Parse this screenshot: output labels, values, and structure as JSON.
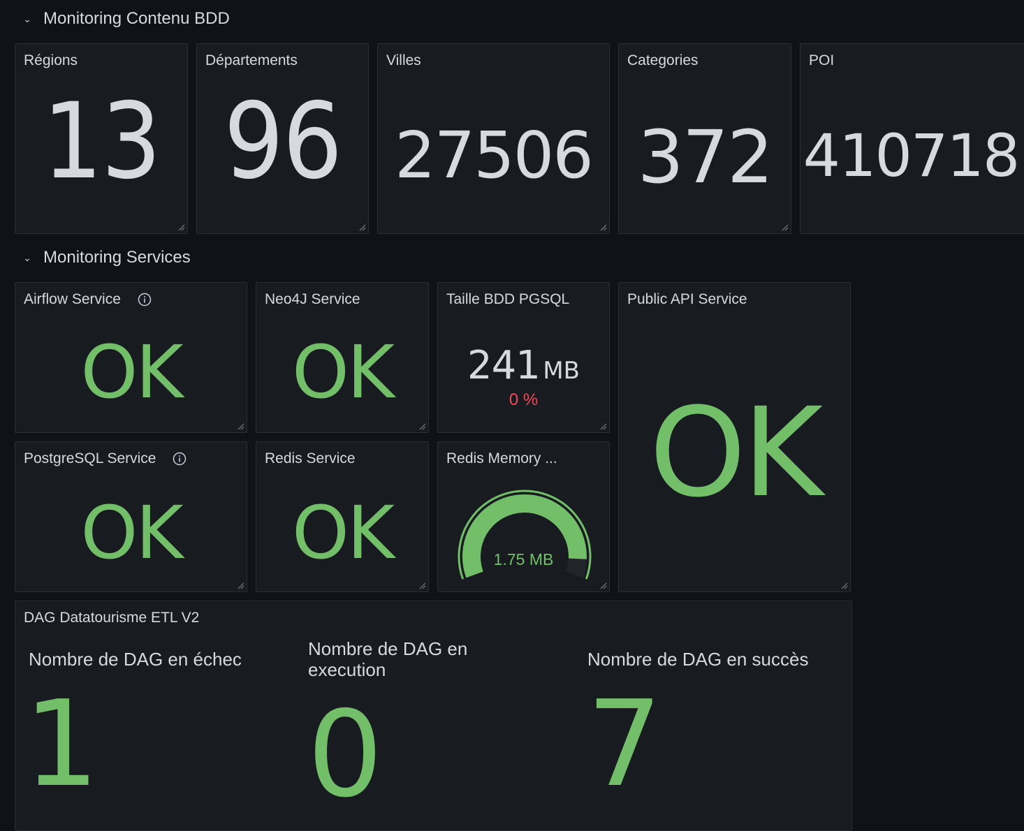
{
  "rows": {
    "bdd": {
      "title": "Monitoring Contenu BDD"
    },
    "services": {
      "title": "Monitoring Services"
    }
  },
  "stats": {
    "regions": {
      "title": "Régions",
      "value": "13"
    },
    "departements": {
      "title": "Départements",
      "value": "96"
    },
    "villes": {
      "title": "Villes",
      "value": "27506"
    },
    "categories": {
      "title": "Categories",
      "value": "372"
    },
    "poi": {
      "title": "POI",
      "value": "410718"
    }
  },
  "services": {
    "airflow": {
      "title": "Airflow Service",
      "value": "OK"
    },
    "neo4j": {
      "title": "Neo4J Service",
      "value": "OK"
    },
    "pgsql_size": {
      "title": "Taille BDD PGSQL",
      "value": "241",
      "unit": "MB",
      "delta": "0 %"
    },
    "public_api": {
      "title": "Public API Service",
      "value": "OK"
    },
    "postgresql": {
      "title": "PostgreSQL Service",
      "value": "OK"
    },
    "redis": {
      "title": "Redis Service",
      "value": "OK"
    },
    "redis_memory": {
      "title": "Redis Memory ...",
      "value": "1.75 MB",
      "gauge_fraction": 0.92
    }
  },
  "dag": {
    "title": "DAG Datatourisme ETL V2",
    "failed": {
      "label": "Nombre de DAG en échec",
      "value": "1"
    },
    "running": {
      "label": "Nombre de DAG en execution",
      "value": "0"
    },
    "success": {
      "label": "Nombre de DAG en succès",
      "value": "7"
    }
  },
  "colors": {
    "background": "#111217",
    "panel": "#181b1f",
    "text": "#d8d9e0",
    "ok_green": "#73bf69",
    "delta_red": "#f2495c"
  },
  "icons": {
    "row_toggle": "chevron-down-icon",
    "info": "info-icon",
    "resize": "resize-handle-icon"
  }
}
